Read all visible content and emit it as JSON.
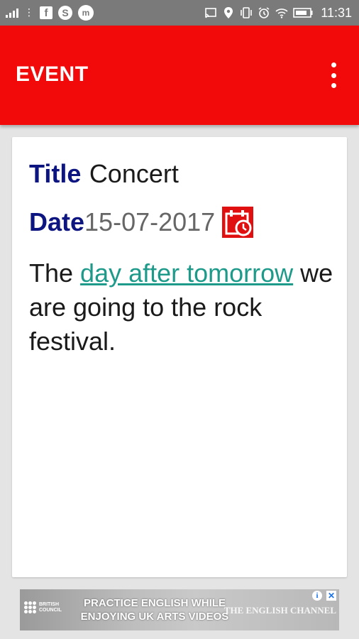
{
  "status_bar": {
    "time": "11:31",
    "left_icons": [
      "signal-icon",
      "more-dots-icon",
      "facebook-icon",
      "skype-icon",
      "messenger-icon"
    ],
    "right_icons": [
      "cast-icon",
      "location-icon",
      "vibrate-icon",
      "alarm-icon",
      "wifi-icon",
      "battery-icon"
    ]
  },
  "app_bar": {
    "title": "EVENT",
    "color": "#f20a0a"
  },
  "event": {
    "title_label": "Title",
    "title_value": "Concert",
    "date_label": "Date",
    "date_value": "15-07-2017",
    "description_before": "The ",
    "description_link": "day after tomorrow",
    "description_after": " we are going to the rock festival.",
    "label_color": "#0d1580",
    "link_color": "#1e9a8a"
  },
  "ad": {
    "logo_line1": "BRITISH",
    "logo_line2": "COUNCIL",
    "headline_line1": "PRACTICE ENGLISH WHILE",
    "headline_line2": "ENJOYING UK ARTS VIDEOS",
    "channel": "THE ENGLISH CHANNEL",
    "info_symbol": "i",
    "close_symbol": "✕"
  }
}
